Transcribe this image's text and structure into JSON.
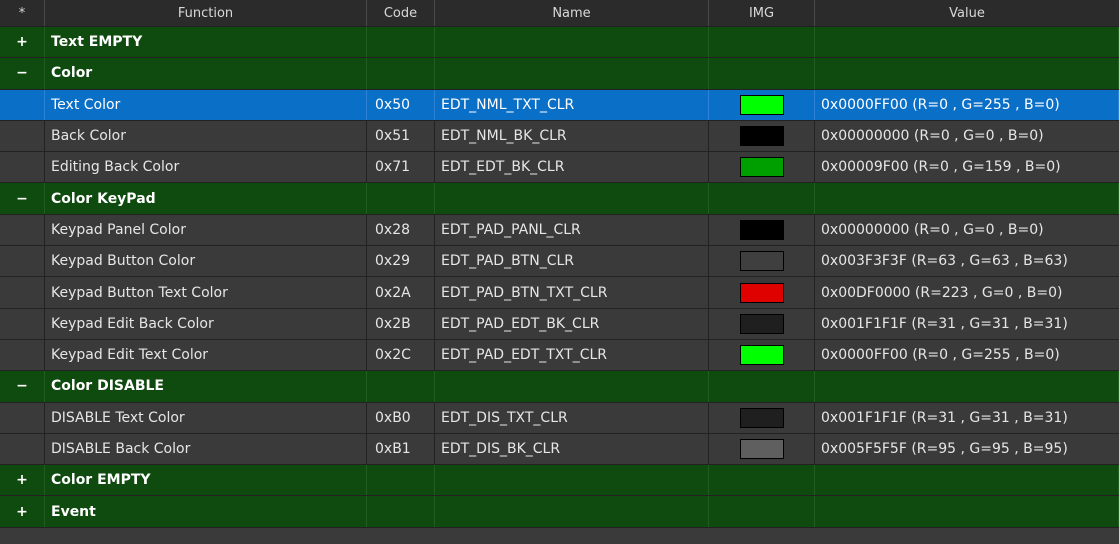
{
  "columns": [
    "*",
    "Function",
    "Code",
    "Name",
    "IMG",
    "Value"
  ],
  "rows": [
    {
      "kind": "group",
      "toggle": "+",
      "label": "Text EMPTY"
    },
    {
      "kind": "group",
      "toggle": "−",
      "label": "Color"
    },
    {
      "kind": "item",
      "selected": true,
      "function": "Text Color",
      "code": "0x50",
      "name": "EDT_NML_TXT_CLR",
      "color": "#00ff00",
      "value": "0x0000FF00 (R=0 , G=255 , B=0)"
    },
    {
      "kind": "item",
      "function": "Back Color",
      "code": "0x51",
      "name": "EDT_NML_BK_CLR",
      "color": "#000000",
      "value": "0x00000000 (R=0 , G=0 , B=0)"
    },
    {
      "kind": "item",
      "function": "Editing Back Color",
      "code": "0x71",
      "name": "EDT_EDT_BK_CLR",
      "color": "#009f00",
      "value": "0x00009F00 (R=0 , G=159 , B=0)"
    },
    {
      "kind": "group",
      "toggle": "−",
      "label": "Color KeyPad"
    },
    {
      "kind": "item",
      "function": "Keypad Panel Color",
      "code": "0x28",
      "name": "EDT_PAD_PANL_CLR",
      "color": "#000000",
      "value": "0x00000000 (R=0 , G=0 , B=0)"
    },
    {
      "kind": "item",
      "function": "Keypad Button Color",
      "code": "0x29",
      "name": "EDT_PAD_BTN_CLR",
      "color": "#3f3f3f",
      "value": "0x003F3F3F (R=63 , G=63 , B=63)"
    },
    {
      "kind": "item",
      "function": "Keypad Button Text Color",
      "code": "0x2A",
      "name": "EDT_PAD_BTN_TXT_CLR",
      "color": "#df0000",
      "value": "0x00DF0000 (R=223 , G=0 , B=0)"
    },
    {
      "kind": "item",
      "function": "Keypad Edit Back Color",
      "code": "0x2B",
      "name": "EDT_PAD_EDT_BK_CLR",
      "color": "#1f1f1f",
      "value": "0x001F1F1F (R=31 , G=31 , B=31)"
    },
    {
      "kind": "item",
      "function": "Keypad Edit Text Color",
      "code": "0x2C",
      "name": "EDT_PAD_EDT_TXT_CLR",
      "color": "#00ff00",
      "value": "0x0000FF00 (R=0 , G=255 , B=0)"
    },
    {
      "kind": "group",
      "toggle": "−",
      "label": "Color DISABLE"
    },
    {
      "kind": "item",
      "function": "DISABLE Text Color",
      "code": "0xB0",
      "name": "EDT_DIS_TXT_CLR",
      "color": "#1f1f1f",
      "value": "0x001F1F1F (R=31 , G=31 , B=31)"
    },
    {
      "kind": "item",
      "function": "DISABLE Back Color",
      "code": "0xB1",
      "name": "EDT_DIS_BK_CLR",
      "color": "#5f5f5f",
      "value": "0x005F5F5F (R=95 , G=95 , B=95)"
    },
    {
      "kind": "group",
      "toggle": "+",
      "label": "Color EMPTY"
    },
    {
      "kind": "group",
      "toggle": "+",
      "label": "Event"
    }
  ]
}
